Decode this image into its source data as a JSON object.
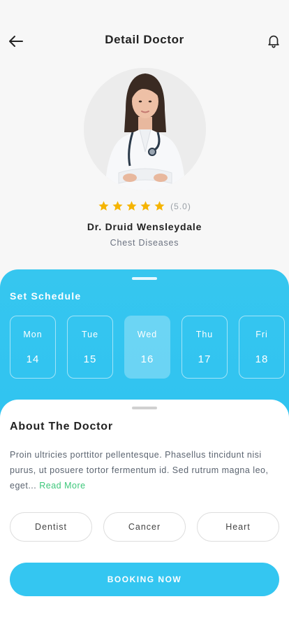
{
  "header": {
    "title": "Detail Doctor",
    "back_icon": "arrow-left-icon",
    "bell_icon": "bell-icon"
  },
  "doctor": {
    "name": "Dr. Druid Wensleydale",
    "specialty": "Chest Diseases",
    "rating": 5.0,
    "rating_text": "(5.0)",
    "stars": 5
  },
  "schedule": {
    "title": "Set Schedule",
    "selected_index": 2,
    "days": [
      {
        "name": "Mon",
        "num": "14"
      },
      {
        "name": "Tue",
        "num": "15"
      },
      {
        "name": "Wed",
        "num": "16"
      },
      {
        "name": "Thu",
        "num": "17"
      },
      {
        "name": "Fri",
        "num": "18"
      }
    ]
  },
  "about": {
    "title": "About The Doctor",
    "text": "Proin ultricies porttitor pellentesque. Phasellus tincidunt nisi purus, ut posuere tortor fermentum id. Sed rutrum magna leo, eget...",
    "read_more": "Read More"
  },
  "tags": [
    "Dentist",
    "Cancer",
    "Heart"
  ],
  "booking": {
    "label": "BOOKING NOW"
  },
  "colors": {
    "accent": "#34c6f1",
    "star": "#f5b400",
    "read_more": "#3cc77a"
  }
}
